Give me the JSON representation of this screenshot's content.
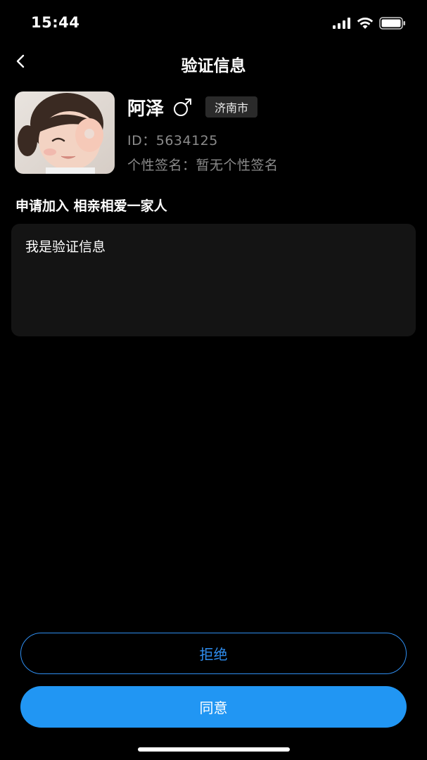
{
  "status_bar": {
    "time": "15:44",
    "icons": [
      "signal-icon",
      "wifi-icon",
      "battery-icon"
    ]
  },
  "nav": {
    "title": "验证信息",
    "back_icon": "chevron-left-icon"
  },
  "profile": {
    "name": "阿泽",
    "gender_icon": "male-icon",
    "city": "济南市",
    "id_text": "ID：5634125",
    "signature_text": "个性签名：暂无个性签名"
  },
  "request": {
    "title": "申请加入 相亲相爱一家人",
    "message": "我是验证信息"
  },
  "actions": {
    "reject_label": "拒绝",
    "agree_label": "同意"
  },
  "colors": {
    "background": "#000000",
    "accent": "#2196F3",
    "reject_border": "#2F8EF0",
    "message_box": "#141414",
    "secondary_text": "#8B8B8B"
  }
}
